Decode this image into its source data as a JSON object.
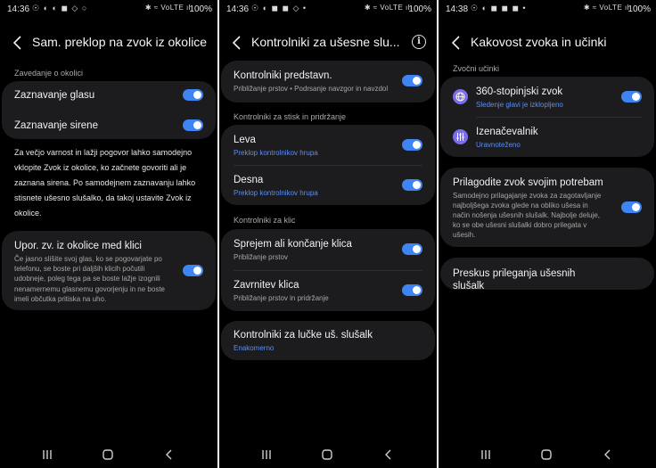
{
  "accent": "#3e84f2",
  "screens": [
    {
      "status": {
        "time": "14:36",
        "battery": "100%",
        "left_icons": "☉ ◐ ◐ ◼ ◇ ○",
        "right_icons": "✱ ≈ VoLTE ıl"
      },
      "title": "Sam. preklop na zvok iz okolice",
      "section1": "Zavedanje o okolici",
      "rows": [
        {
          "title": "Zaznavanje glasu"
        },
        {
          "title": "Zaznavanje sirene"
        }
      ],
      "paragraph": "Za večjo varnost in lažji pogovor lahko samodejno vklopite Zvok iz okolice, ko začnete govoriti ali je zaznana sirena. Po samodejnem zaznavanju lahko stisnete ušesno slušalko, da takoj ustavite Zvok iz okolice.",
      "feature": {
        "title": "Upor. zv. iz okolice med klici",
        "desc": "Če jasno slišite svoj glas, ko se pogovarjate po telefonu, se boste pri daljših klicih počutili udobneje, poleg tega pa se boste lažje izognili nenamernemu glasnemu govorjenju in ne boste imeli občutka pritiska na uho."
      }
    },
    {
      "status": {
        "time": "14:36",
        "battery": "100%",
        "left_icons": "☉ ◐ ◼ ◼ ◇ •",
        "right_icons": "✱ ≈ VoLTE ıl"
      },
      "title": "Kontrolniki za ušesne slu...",
      "top_row": {
        "title": "Kontrolniki predstavn.",
        "sub": "Približanje prstov • Podrsanje navzgor in navzdol"
      },
      "section1": "Kontrolniki za stisk in pridržanje",
      "press_rows": [
        {
          "title": "Leva",
          "sub": "Preklop kontrolnikov hrupa"
        },
        {
          "title": "Desna",
          "sub": "Preklop kontrolnikov hrupa"
        }
      ],
      "section2": "Kontrolniki za klic",
      "call_rows": [
        {
          "title": "Sprejem ali končanje klica",
          "sub": "Približanje prstov"
        },
        {
          "title": "Zavrnitev klica",
          "sub": "Približanje prstov in pridržanje"
        }
      ],
      "bottom_row": {
        "title": "Kontrolniki za lučke uš. slušalk",
        "sub": "Enakomerno"
      }
    },
    {
      "status": {
        "time": "14:38",
        "battery": "100%",
        "left_icons": "☉ ◐ ◼ ◼ ◼ •",
        "right_icons": "✱ ≈ VoLTE ıl"
      },
      "title": "Kakovost zvoka in učinki",
      "section1": "Zvočni učinki",
      "rows": [
        {
          "title": "360-stopinjski zvok",
          "sub": "Sledenje glavi je izklopljeno",
          "icon": "360-audio-icon"
        },
        {
          "title": "Izenačevalnik",
          "sub": "Uravnoteženo",
          "icon": "equalizer-icon"
        }
      ],
      "adapt": {
        "title": "Prilagodite zvok svojim potrebam",
        "desc": "Samodejno prilagajanje zvoka za zagotavljanje najboljšega zvoka glede na obliko ušesa in način nošenja ušesnih slušalk. Najbolje deluje, ko se obe ušesni slušalki dobro prilegata v ušesih."
      },
      "fit_test": "Preskus prileganja ušesnih slušalk"
    }
  ]
}
